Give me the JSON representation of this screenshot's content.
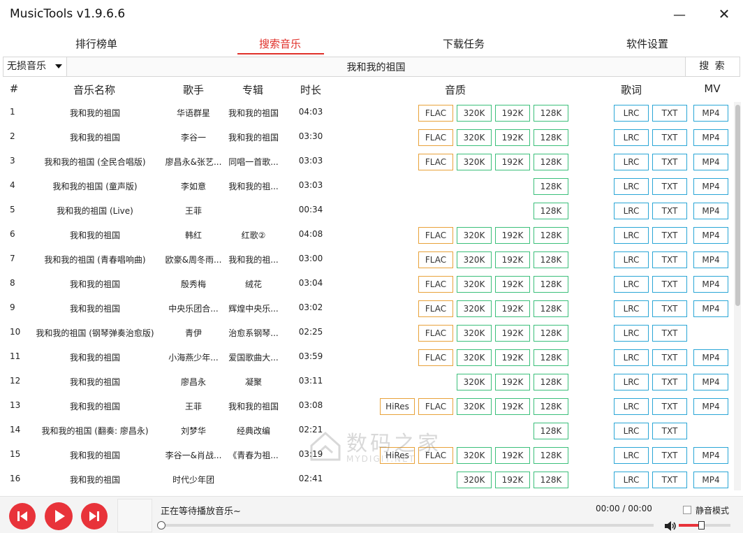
{
  "app": {
    "title": "MusicTools v1.9.6.6",
    "minimize": "—",
    "close": "✕"
  },
  "tabs": [
    {
      "label": "排行榜单"
    },
    {
      "label": "搜索音乐"
    },
    {
      "label": "下载任务"
    },
    {
      "label": "软件设置"
    }
  ],
  "active_tab": "搜索音乐",
  "search": {
    "quality": "无损音乐",
    "query": "我和我的祖国",
    "button": "搜 索"
  },
  "columns": {
    "num": "#",
    "name": "音乐名称",
    "artist": "歌手",
    "album": "专辑",
    "duration": "时长",
    "quality": "音质",
    "lyrics": "歌词",
    "mv": "MV"
  },
  "buttons": {
    "hires": "HiRes",
    "flac": "FLAC",
    "k320": "320K",
    "k192": "192K",
    "k128": "128K",
    "lrc": "LRC",
    "txt": "TXT",
    "mp4": "MP4"
  },
  "rows": [
    {
      "num": "1",
      "name": "我和我的祖国",
      "artist": "华语群星",
      "album": "我和我的祖国",
      "duration": "04:03",
      "q": [
        "flac",
        "k320",
        "k192",
        "k128"
      ],
      "mv": true
    },
    {
      "num": "2",
      "name": "我和我的祖国",
      "artist": "李谷一",
      "album": "我和我的祖国",
      "duration": "03:30",
      "q": [
        "flac",
        "k320",
        "k192",
        "k128"
      ],
      "mv": true
    },
    {
      "num": "3",
      "name": "我和我的祖国 (全民合唱版)",
      "artist": "廖昌永&张艺...",
      "album": "同唱一首歌...",
      "duration": "03:03",
      "q": [
        "flac",
        "k320",
        "k192",
        "k128"
      ],
      "mv": true
    },
    {
      "num": "4",
      "name": "我和我的祖国 (童声版)",
      "artist": "李如意",
      "album": "我和我的祖...",
      "duration": "03:03",
      "q": [
        "k128"
      ],
      "mv": true
    },
    {
      "num": "5",
      "name": "我和我的祖国 (Live)",
      "artist": "王菲",
      "album": "",
      "duration": "00:34",
      "q": [
        "k128"
      ],
      "mv": true
    },
    {
      "num": "6",
      "name": "我和我的祖国",
      "artist": "韩红",
      "album": "红歌②",
      "duration": "04:08",
      "q": [
        "flac",
        "k320",
        "k192",
        "k128"
      ],
      "mv": true
    },
    {
      "num": "7",
      "name": "我和我的祖国 (青春唱响曲)",
      "artist": "欧豪&周冬雨...",
      "album": "我和我的祖...",
      "duration": "03:00",
      "q": [
        "flac",
        "k320",
        "k192",
        "k128"
      ],
      "mv": true
    },
    {
      "num": "8",
      "name": "我和我的祖国",
      "artist": "殷秀梅",
      "album": "绒花",
      "duration": "03:04",
      "q": [
        "flac",
        "k320",
        "k192",
        "k128"
      ],
      "mv": true
    },
    {
      "num": "9",
      "name": "我和我的祖国",
      "artist": "中央乐团合...",
      "album": "辉煌中央乐...",
      "duration": "03:02",
      "q": [
        "flac",
        "k320",
        "k192",
        "k128"
      ],
      "mv": true
    },
    {
      "num": "10",
      "name": "我和我的祖国 (钢琴弹奏治愈版)",
      "artist": "青伊",
      "album": "治愈系钢琴...",
      "duration": "02:25",
      "q": [
        "flac",
        "k320",
        "k192",
        "k128"
      ],
      "mv": false
    },
    {
      "num": "11",
      "name": "我和我的祖国",
      "artist": "小海燕少年...",
      "album": "爱国歌曲大...",
      "duration": "03:59",
      "q": [
        "flac",
        "k320",
        "k192",
        "k128"
      ],
      "mv": true
    },
    {
      "num": "12",
      "name": "我和我的祖国",
      "artist": "廖昌永",
      "album": "凝聚",
      "duration": "03:11",
      "q": [
        "k320",
        "k192",
        "k128"
      ],
      "mv": true
    },
    {
      "num": "13",
      "name": "我和我的祖国",
      "artist": "王菲",
      "album": "我和我的祖国",
      "duration": "03:08",
      "q": [
        "hires",
        "flac",
        "k320",
        "k192",
        "k128"
      ],
      "mv": true
    },
    {
      "num": "14",
      "name": "我和我的祖国 (翻奏: 廖昌永)",
      "artist": "刘梦华",
      "album": "经典改编",
      "duration": "02:21",
      "q": [
        "k128"
      ],
      "mv": false
    },
    {
      "num": "15",
      "name": "我和我的祖国",
      "artist": "李谷一&肖战...",
      "album": "《青春为祖...",
      "duration": "03:19",
      "q": [
        "hires",
        "flac",
        "k320",
        "k192",
        "k128"
      ],
      "mv": true
    },
    {
      "num": "16",
      "name": "我和我的祖国",
      "artist": "时代少年团",
      "album": "",
      "duration": "02:41",
      "q": [
        "k320",
        "k192",
        "k128"
      ],
      "mv": true
    }
  ],
  "player": {
    "status": "正在等待播放音乐~",
    "time": "00:00 / 00:00",
    "mute_label": "静音模式",
    "muted": false,
    "progress_pct": 0,
    "volume_pct": 45
  },
  "watermark": {
    "big": "数码之家",
    "small": "MYDIGIT.NET"
  },
  "colors": {
    "accent": "#e0302a",
    "flac": "#e8a23a",
    "bitrate": "#3bbf7a",
    "lyrics": "#2aa6d6",
    "player_button": "#e8333a"
  }
}
